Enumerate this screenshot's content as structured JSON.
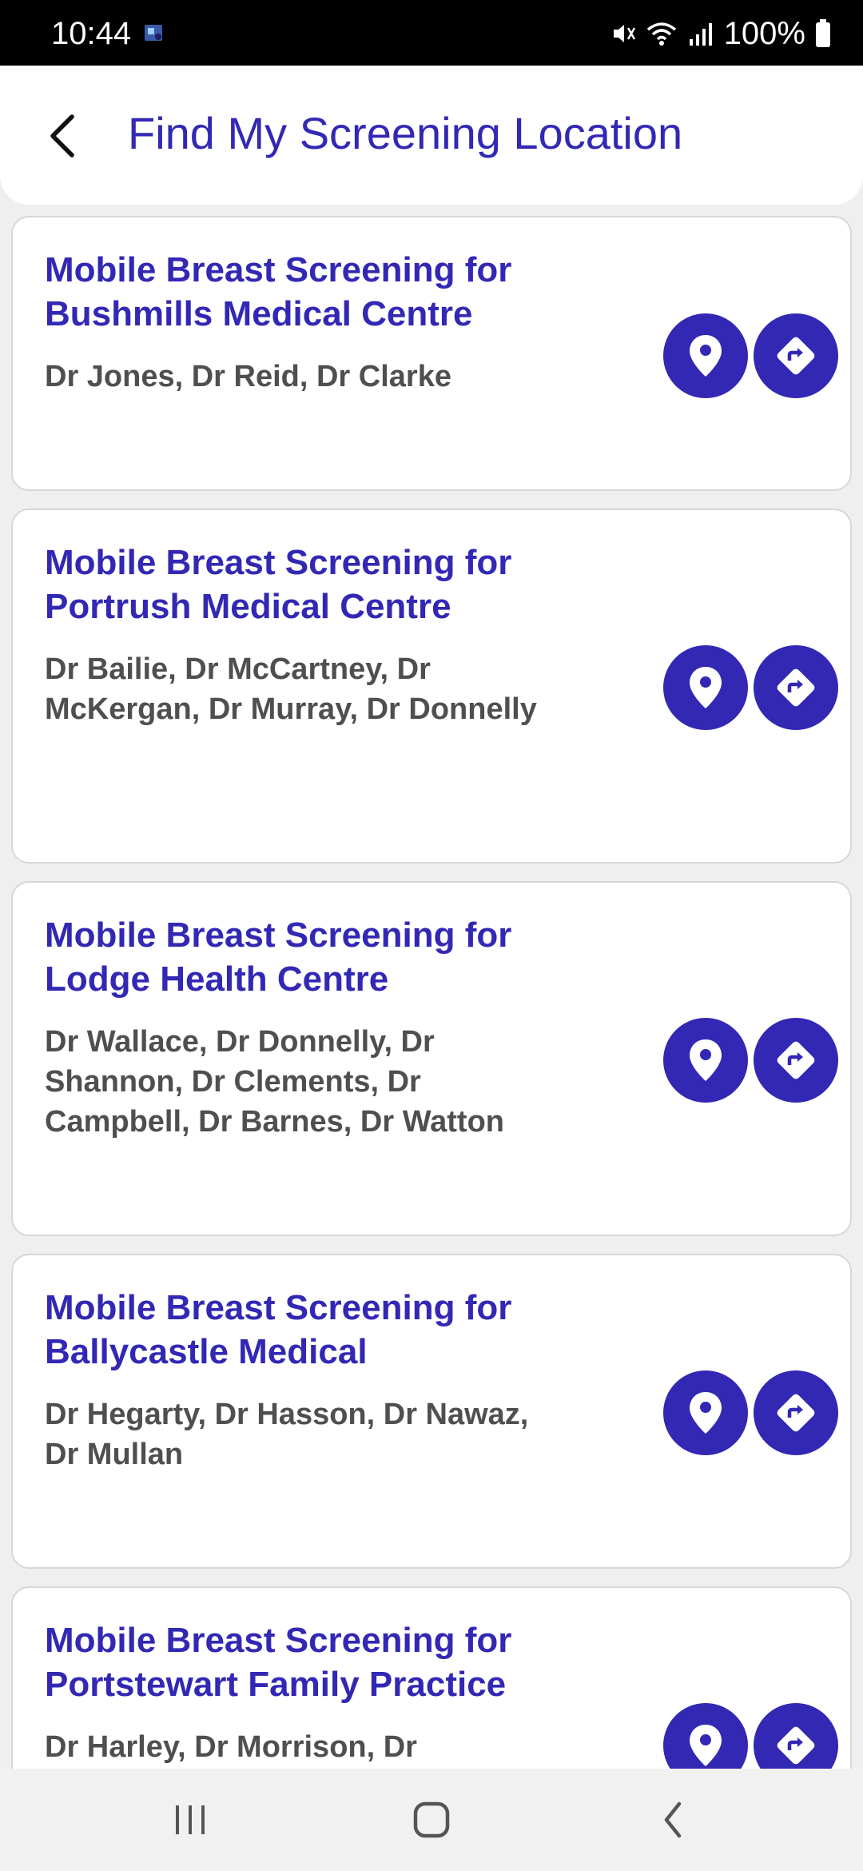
{
  "status_bar": {
    "time": "10:44",
    "battery": "100%",
    "icons": [
      "notification-icon",
      "mute-icon",
      "wifi-icon",
      "signal-icon",
      "battery-icon"
    ]
  },
  "header": {
    "title": "Find My Screening Location",
    "back_icon": "back-arrow-icon"
  },
  "locations": [
    {
      "title": "Mobile Breast Screening for Bushmills Medical Centre",
      "doctors": "Dr Jones, Dr Reid, Dr Clarke"
    },
    {
      "title": "Mobile Breast Screening for Portrush Medical Centre",
      "doctors": "Dr Bailie, Dr McCartney, Dr McKergan, Dr Murray, Dr Donnelly"
    },
    {
      "title": "Mobile Breast Screening for Lodge Health Centre",
      "doctors": "Dr Wallace, Dr Donnelly, Dr Shannon, Dr Clements, Dr Campbell, Dr Barnes, Dr Watton"
    },
    {
      "title": "Mobile Breast Screening for Ballycastle Medical",
      "doctors": "Dr Hegarty, Dr Hasson, Dr Nawaz, Dr Mullan"
    },
    {
      "title": "Mobile Breast Screening for Portstewart Family Practice",
      "doctors": "Dr Harley, Dr Morrison, Dr"
    }
  ],
  "card_buttons": {
    "location_icon": "map-pin-icon",
    "directions_icon": "directions-icon"
  },
  "colors": {
    "accent": "#3228b4",
    "doctor_text": "#4f4f4f",
    "background": "#efefef"
  },
  "nav_bar": {
    "icons": [
      "recent-apps-icon",
      "home-icon",
      "back-icon"
    ]
  }
}
